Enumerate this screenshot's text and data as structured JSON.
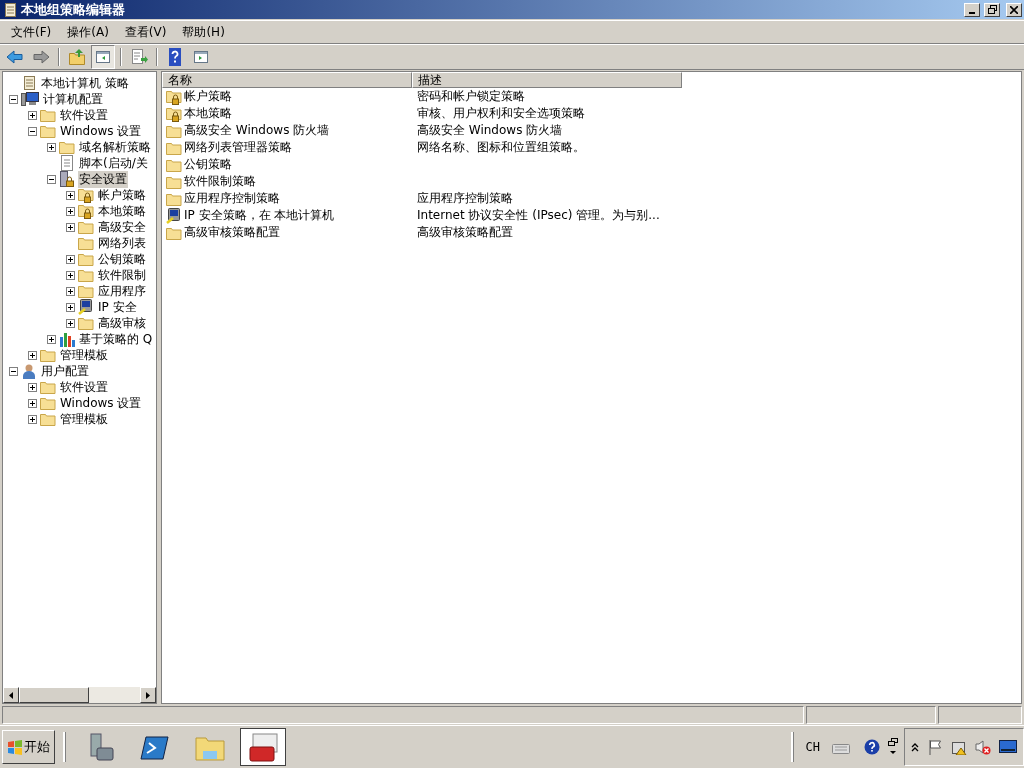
{
  "window": {
    "title": "本地组策略编辑器"
  },
  "menu": [
    "文件(F)",
    "操作(A)",
    "查看(V)",
    "帮助(H)"
  ],
  "toolbar": [
    {
      "kind": "back"
    },
    {
      "kind": "forward"
    },
    {
      "kind": "sep"
    },
    {
      "kind": "up"
    },
    {
      "kind": "tree-toggle",
      "selected": true
    },
    {
      "kind": "sep"
    },
    {
      "kind": "export"
    },
    {
      "kind": "sep"
    },
    {
      "kind": "help"
    },
    {
      "kind": "pane"
    }
  ],
  "tree": [
    {
      "label": "本地计算机 策略",
      "kind": "policy",
      "selected": false,
      "children": [
        {
          "label": "计算机配置",
          "kind": "computer",
          "expanded": true,
          "selected": false,
          "children": [
            {
              "label": "软件设置",
              "kind": "folder",
              "expanded": false,
              "selected": false
            },
            {
              "label": "Windows 设置",
              "kind": "folder",
              "expanded": true,
              "selected": false,
              "children": [
                {
                  "label": "域名解析策略",
                  "kind": "folder",
                  "expanded": false,
                  "selected": false
                },
                {
                  "label": "脚本(启动/关",
                  "kind": "script",
                  "selected": false
                },
                {
                  "label": "安全设置",
                  "kind": "security",
                  "expanded": true,
                  "selected": true,
                  "children": [
                    {
                      "label": "帐户策略",
                      "kind": "folder-lock",
                      "expanded": false,
                      "selected": false
                    },
                    {
                      "label": "本地策略",
                      "kind": "folder-lock",
                      "expanded": false,
                      "selected": false
                    },
                    {
                      "label": "高级安全",
                      "kind": "folder",
                      "expanded": false,
                      "selected": false
                    },
                    {
                      "label": "网络列表",
                      "kind": "folder",
                      "selected": false
                    },
                    {
                      "label": "公钥策略",
                      "kind": "folder",
                      "expanded": false,
                      "selected": false
                    },
                    {
                      "label": "软件限制",
                      "kind": "folder",
                      "expanded": false,
                      "selected": false
                    },
                    {
                      "label": "应用程序",
                      "kind": "folder",
                      "expanded": false,
                      "selected": false
                    },
                    {
                      "label": "IP 安全",
                      "kind": "ip",
                      "expanded": false,
                      "selected": false
                    },
                    {
                      "label": "高级审核",
                      "kind": "folder",
                      "expanded": false,
                      "selected": false
                    }
                  ]
                },
                {
                  "label": "基于策略的 Q",
                  "kind": "chart",
                  "expanded": false,
                  "selected": false
                }
              ]
            },
            {
              "label": "管理模板",
              "kind": "folder",
              "expanded": false,
              "selected": false
            }
          ]
        },
        {
          "label": "用户配置",
          "kind": "user",
          "expanded": true,
          "selected": false,
          "children": [
            {
              "label": "软件设置",
              "kind": "folder",
              "expanded": false,
              "selected": false
            },
            {
              "label": "Windows 设置",
              "kind": "folder",
              "expanded": false,
              "selected": false
            },
            {
              "label": "管理模板",
              "kind": "folder",
              "expanded": false,
              "selected": false
            }
          ]
        }
      ]
    }
  ],
  "table": {
    "columns": [
      "名称",
      "描述"
    ],
    "rows": [
      {
        "kind": "folder-lock",
        "name": "帐户策略",
        "description": "密码和帐户锁定策略"
      },
      {
        "kind": "folder-lock",
        "name": "本地策略",
        "description": "审核、用户权利和安全选项策略"
      },
      {
        "kind": "folder",
        "name": "高级安全 Windows 防火墙",
        "description": "高级安全 Windows 防火墙"
      },
      {
        "kind": "folder",
        "name": "网络列表管理器策略",
        "description": "网络名称、图标和位置组策略。"
      },
      {
        "kind": "folder",
        "name": "公钥策略"
      },
      {
        "kind": "folder",
        "name": "软件限制策略"
      },
      {
        "kind": "folder",
        "name": "应用程序控制策略",
        "description": "应用程序控制策略"
      },
      {
        "kind": "ip",
        "name": "IP 安全策略，在 本地计算机",
        "description": "Internet 协议安全性 (IPsec) 管理。为与别..."
      },
      {
        "kind": "folder",
        "name": "高级审核策略配置",
        "description": "高级审核策略配置"
      }
    ]
  },
  "taskbar": {
    "start": "开始",
    "apps": [
      {
        "kind": "server-manager",
        "selected": false
      },
      {
        "kind": "powershell",
        "selected": false
      },
      {
        "kind": "explorer",
        "selected": false
      },
      {
        "kind": "toolbox",
        "selected": true
      }
    ],
    "language": "CH",
    "tray": [
      {
        "kind": "flag"
      },
      {
        "kind": "network-warning"
      },
      {
        "kind": "volume-muted"
      },
      {
        "kind": "monitor"
      }
    ]
  }
}
